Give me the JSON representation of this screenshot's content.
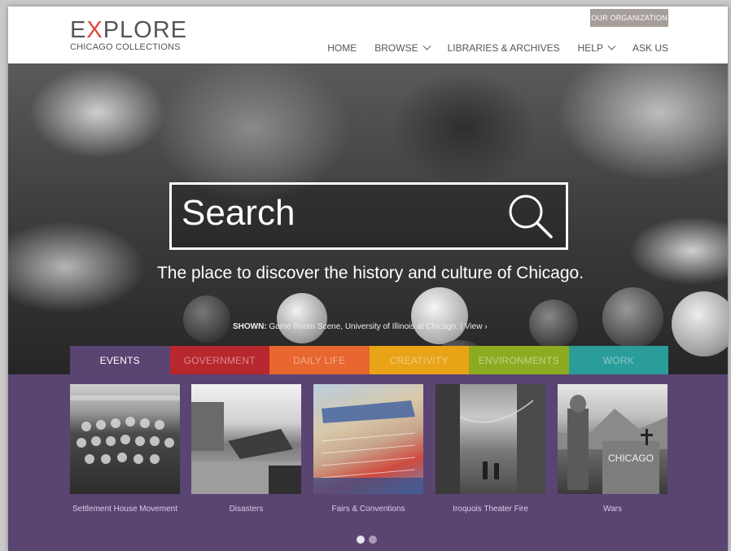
{
  "header": {
    "logo": {
      "prefix": "E",
      "x": "X",
      "suffix": "PLORE",
      "sub": "CHICAGO COLLECTIONS"
    },
    "org_button": "OUR ORGANIZATION",
    "nav": [
      {
        "label": "HOME",
        "dropdown": false
      },
      {
        "label": "BROWSE",
        "dropdown": true
      },
      {
        "label": "LIBRARIES & ARCHIVES",
        "dropdown": false
      },
      {
        "label": "HELP",
        "dropdown": true
      },
      {
        "label": "ASK US",
        "dropdown": false
      }
    ]
  },
  "hero": {
    "search_label": "Search",
    "tagline": "The place to discover the history and culture of Chicago.",
    "credit_prefix": "SHOWN:",
    "credit_text": " Game Room Scene, University of Illinois at Chicago.  | View ›"
  },
  "tabs": [
    {
      "label": "EVENTS",
      "color": "#5a4472",
      "active": true
    },
    {
      "label": "GOVERNMENT",
      "color": "#b8272e",
      "active": false
    },
    {
      "label": "DAILY LIFE",
      "color": "#e8662f",
      "active": false
    },
    {
      "label": "CREATIVITY",
      "color": "#e8a317",
      "active": false
    },
    {
      "label": "ENVIRONMENTS",
      "color": "#8cab21",
      "active": false
    },
    {
      "label": "WORK",
      "color": "#2a9d9a",
      "active": false
    }
  ],
  "cards": [
    {
      "label": "Settlement House Movement",
      "icon": "settlement-house-photo"
    },
    {
      "label": "Disasters",
      "icon": "disasters-photo"
    },
    {
      "label": "Fairs & Conventions",
      "icon": "fairs-conventions-illustration"
    },
    {
      "label": "Iroquois Theater Fire",
      "icon": "iroquois-fire-photo"
    },
    {
      "label": "Wars",
      "icon": "wars-photo"
    }
  ],
  "carousel": {
    "pages": 2,
    "active_index": 0
  }
}
